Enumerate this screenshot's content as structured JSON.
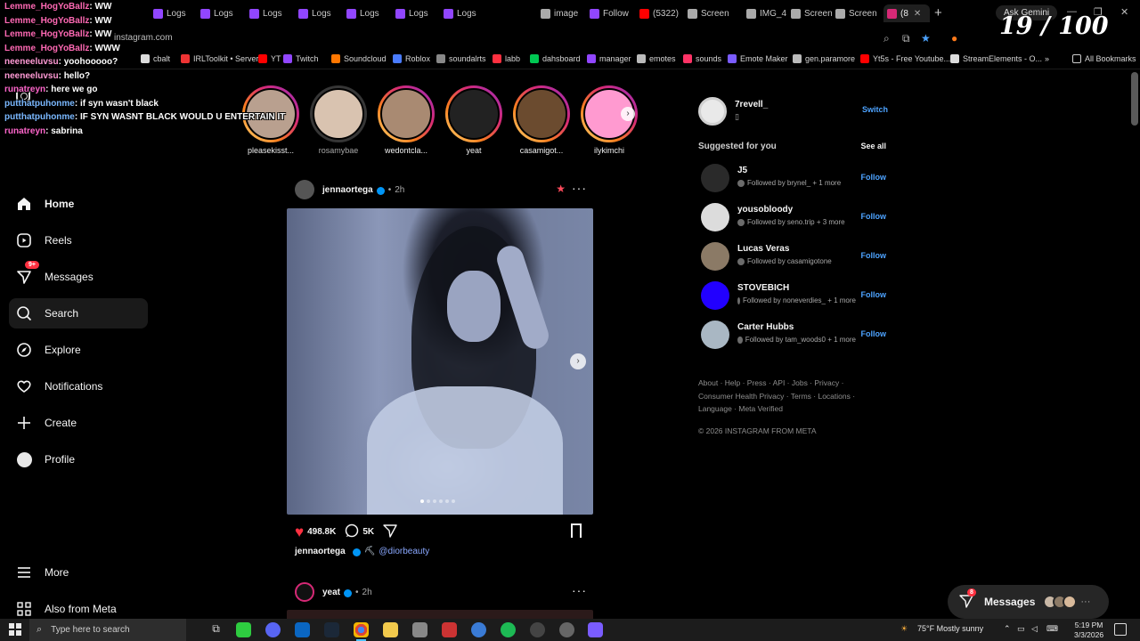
{
  "browser": {
    "tabs": [
      {
        "label": "Logs",
        "color": "#9146ff"
      },
      {
        "label": "Logs",
        "color": "#9146ff"
      },
      {
        "label": "Logs",
        "color": "#9146ff"
      },
      {
        "label": "Logs",
        "color": "#9146ff"
      },
      {
        "label": "Logs",
        "color": "#9146ff"
      },
      {
        "label": "Logs",
        "color": "#9146ff"
      },
      {
        "label": "Logs",
        "color": "#9146ff"
      },
      {
        "label": "image",
        "color": "#aaaaaa"
      },
      {
        "label": "Follow",
        "color": "#9146ff"
      },
      {
        "label": "(5322)",
        "color": "#ff0000"
      },
      {
        "label": "Screen",
        "color": "#aaaaaa"
      },
      {
        "label": "IMG_4",
        "color": "#aaaaaa"
      },
      {
        "label": "Screen",
        "color": "#aaaaaa"
      },
      {
        "label": "Screen",
        "color": "#aaaaaa"
      },
      {
        "label": "(8",
        "color": "#d62976",
        "active": true
      }
    ],
    "new_tab": "+",
    "ask_gemini": "Ask Gemini",
    "url": "instagram.com",
    "bookmarks": [
      {
        "label": "cbalt",
        "color": "#dddddd"
      },
      {
        "label": "IRLToolkit • Server",
        "color": "#e33"
      },
      {
        "label": "YT",
        "color": "#ff0000"
      },
      {
        "label": "Twitch",
        "color": "#9146ff"
      },
      {
        "label": "Soundcloud",
        "color": "#ff7700"
      },
      {
        "label": "Roblox",
        "color": "#4a7cff"
      },
      {
        "label": "soundalrts",
        "color": "#888888"
      },
      {
        "label": "labb",
        "color": "#ff3040"
      },
      {
        "label": "dahsboard",
        "color": "#00c853"
      },
      {
        "label": "manager",
        "color": "#9146ff"
      },
      {
        "label": "emotes",
        "color": "#bbbbbb"
      },
      {
        "label": "sounds",
        "color": "#ff3366"
      },
      {
        "label": "Emote Maker",
        "color": "#7a5cff"
      },
      {
        "label": "gen.paramore",
        "color": "#bbbbbb"
      },
      {
        "label": "Yt5s - Free Youtube...",
        "color": "#ff0000"
      },
      {
        "label": "StreamElements - O...",
        "color": "#dddddd"
      }
    ],
    "bookmarks_more": "»",
    "all_bookmarks": "All Bookmarks"
  },
  "overlay": {
    "counter": "19 / 100",
    "chat": [
      {
        "user": "Lemme_HogYoBallz",
        "msg": "WW",
        "color": "#ff69b4"
      },
      {
        "user": "Lemme_HogYoBallz",
        "msg": "WW",
        "color": "#ff69b4"
      },
      {
        "user": "Lemme_HogYoBallz",
        "msg": "WW",
        "color": "#ff69b4"
      },
      {
        "user": "Lemme_HogYoBallz",
        "msg": "WWW",
        "color": "#ff69b4"
      },
      {
        "user": "neeneeluvsu",
        "msg": "yoohooooo?",
        "color": "#ff9ad5"
      },
      {
        "user": "neeneeluvsu",
        "msg": "hello?",
        "color": "#ff9ad5"
      },
      {
        "user": "runatreyn",
        "msg": "here we go",
        "color": "#ff66cc"
      },
      {
        "user": "putthatpuhonme",
        "msg": "if syn wasn't black",
        "color": "#7ab8ff"
      },
      {
        "user": "putthatpuhonme",
        "msg": "IF SYN WASNT BLACK WOULD U ENTERTAIN IT",
        "color": "#7ab8ff"
      },
      {
        "user": "runatreyn",
        "msg": "sabrina",
        "color": "#ff66cc"
      }
    ]
  },
  "nav": {
    "home": "Home",
    "reels": "Reels",
    "messages": "Messages",
    "messages_badge": "9+",
    "search": "Search",
    "explore": "Explore",
    "notifications": "Notifications",
    "create": "Create",
    "profile": "Profile",
    "more": "More",
    "also_from_meta": "Also from Meta"
  },
  "stories": [
    {
      "name": "pleasekisst...",
      "seen": false,
      "color": "#b9a08f"
    },
    {
      "name": "rosamybae",
      "seen": true,
      "color": "#d9c3b0"
    },
    {
      "name": "wedontcla...",
      "seen": false,
      "color": "#a98a72"
    },
    {
      "name": "yeat",
      "seen": false,
      "color": "#222222"
    },
    {
      "name": "casamigot...",
      "seen": false,
      "color": "#6b4b2f"
    },
    {
      "name": "ilykimchi",
      "seen": false,
      "color": "#ff9ad0"
    }
  ],
  "feed": {
    "post1": {
      "user": "jennaortega",
      "time": "2h",
      "likes": "498.8K",
      "comments": "5K",
      "caption_user": "jennaortega",
      "caption_emoji": "⛏",
      "caption_mention": "@diorbeauty",
      "carousel_total": 6,
      "carousel_index": 1
    },
    "post2": {
      "user": "yeat",
      "time": "2h"
    },
    "dot_sep": "•"
  },
  "sidebar_right": {
    "me_name": "7revell_",
    "me_sub": "▯",
    "switch": "Switch",
    "suggested_title": "Suggested for you",
    "see_all": "See all",
    "follow_label": "Follow",
    "suggestions": [
      {
        "name": "J5",
        "sub": "Followed by brynel_ + 1 more",
        "color": "#2a2a2a"
      },
      {
        "name": "yousobloody",
        "sub": "Followed by seno.trip + 3 more",
        "color": "#dcdcdc"
      },
      {
        "name": "Lucas Veras",
        "sub": "Followed by casamigotone",
        "color": "#8b7a66"
      },
      {
        "name": "STOVEBICH",
        "sub": "Followed by noneverdies_ + 1 more",
        "color": "#2200ff"
      },
      {
        "name": "Carter Hubbs",
        "sub": "Followed by tam_woods0 + 1 more",
        "color": "#a9b7c3"
      }
    ],
    "footer_line1": "About · Help · Press · API · Jobs · Privacy ·",
    "footer_line2": "Consumer Health Privacy · Terms · Locations ·",
    "footer_line3": "Language · Meta Verified",
    "copyright": "© 2026 INSTAGRAM FROM META"
  },
  "messages_pill": {
    "label": "Messages",
    "badge": "8",
    "more": "···"
  },
  "taskbar": {
    "search_placeholder": "Type here to search",
    "weather": "75°F  Mostly sunny",
    "time": "5:19 PM",
    "date": "3/3/2026"
  }
}
